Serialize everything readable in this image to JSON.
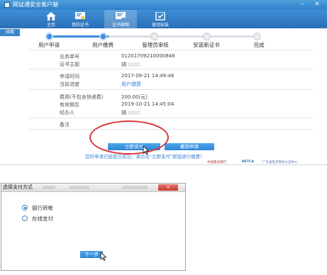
{
  "window": {
    "title": "网证通安全客户端",
    "minimize_glyph": "–",
    "close_glyph": "×"
  },
  "toolbar": {
    "items": [
      {
        "label": "主页",
        "icon": "home-icon"
      },
      {
        "label": "我的证书",
        "icon": "certificate-icon"
      },
      {
        "label": "证书续期",
        "icon": "renew-icon"
      },
      {
        "label": "驱动安装",
        "icon": "driver-install-icon"
      }
    ],
    "active_index": 2
  },
  "side_tab": "续期",
  "progress": {
    "steps": [
      "用户申请",
      "用户缴费",
      "管理员审核",
      "安装新证书",
      "完成"
    ],
    "current_step": 2
  },
  "details": [
    {
      "label": "业务单号",
      "value": "01201709210000846"
    },
    {
      "label": "证书主题",
      "value": "胡"
    },
    {
      "label": "申请时间",
      "value": "2017-09-21 14:49:48"
    },
    {
      "label": "当前进度",
      "value": "用户缴费"
    },
    {
      "label": "费用(不包含快递费)",
      "value": "200.00(元)"
    },
    {
      "label": "有效期至",
      "value": "2019-10-21 14:45:04"
    },
    {
      "label": "经办人",
      "value": "胡"
    },
    {
      "label": "备注",
      "value": ""
    }
  ],
  "actions": {
    "pay_now": "立即支付",
    "revoke": "撤销申请"
  },
  "hint": "您的申请已经提交成功，请点击\"立即支付\"按钮进行缴费！",
  "footer": {
    "logo1": "中国建设银行",
    "logo2": "NETCA",
    "logo3": "广东省电子政务认证中心"
  },
  "colors": {
    "accent": "#2d86d8",
    "highlight_circle": "#d7363a",
    "done_step": "#3a8ee0"
  },
  "payment_dialog": {
    "title": "选择支付方式",
    "close_glyph": "×",
    "options": [
      {
        "label": "银行转帐",
        "selected": true
      },
      {
        "label": "在线支付",
        "selected": false
      }
    ],
    "next_button": "下一步"
  }
}
